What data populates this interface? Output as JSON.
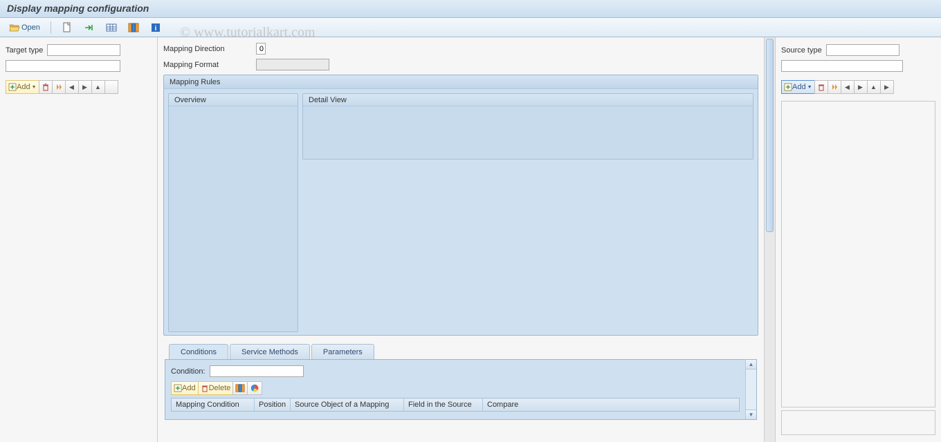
{
  "title": "Display mapping configuration",
  "watermark": "© www.tutorialkart.com",
  "toolbar": {
    "open_label": "Open"
  },
  "left": {
    "target_type_label": "Target type",
    "target_type_value": "",
    "search_value": "",
    "add_label": "Add"
  },
  "center": {
    "mapping_direction_label": "Mapping Direction",
    "mapping_direction_value": "0",
    "mapping_format_label": "Mapping Format",
    "mapping_format_value": "",
    "mapping_rules_title": "Mapping Rules",
    "overview_label": "Overview",
    "detail_view_label": "Detail View",
    "tabs": {
      "conditions": "Conditions",
      "service_methods": "Service Methods",
      "parameters": "Parameters"
    },
    "condition_label": "Condition:",
    "condition_value": "",
    "cond_add_label": "Add",
    "cond_delete_label": "Delete",
    "grid": {
      "c1": "Mapping Condition",
      "c2": "Position",
      "c3": "Source Object of a Mapping",
      "c4": "Field in the Source",
      "c5": "Compare"
    }
  },
  "right": {
    "source_type_label": "Source type",
    "source_type_value": "",
    "search_value": "",
    "add_label": "Add"
  }
}
